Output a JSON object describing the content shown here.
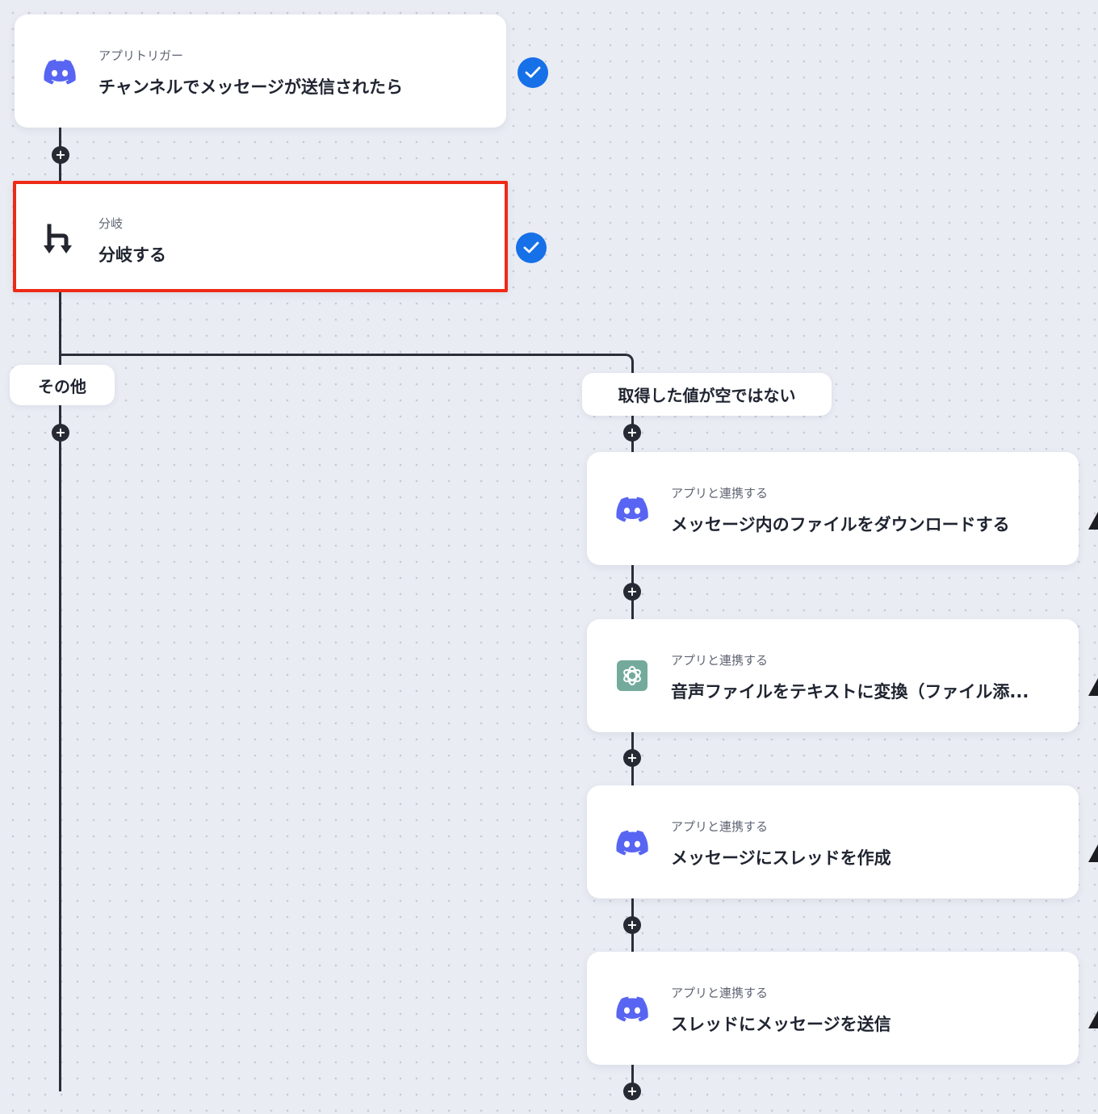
{
  "flow": {
    "trigger": {
      "icon": "discord-icon",
      "subtitle": "アプリトリガー",
      "title": "チャンネルでメッセージが送信されたら",
      "status": "complete"
    },
    "branch": {
      "icon": "branch-icon",
      "subtitle": "分岐",
      "title": "分岐する",
      "status": "complete",
      "selected": true
    },
    "branches": {
      "other_label": "その他",
      "condition_label": "取得した値が空ではない"
    },
    "steps": [
      {
        "icon": "discord-icon",
        "subtitle": "アプリと連携する",
        "title": "メッセージ内のファイルをダウンロードする"
      },
      {
        "icon": "openai-icon",
        "subtitle": "アプリと連携する",
        "title": "音声ファイルをテキストに変換（ファイル添..."
      },
      {
        "icon": "discord-icon",
        "subtitle": "アプリと連携する",
        "title": "メッセージにスレッドを作成"
      },
      {
        "icon": "discord-icon",
        "subtitle": "アプリと連携する",
        "title": "スレッドにメッセージを送信"
      }
    ]
  },
  "colors": {
    "discord": "#5865f2",
    "openai": "#74aa9c",
    "check": "#1670e8",
    "selected_border": "#ee2a16",
    "connector": "#2a2e38"
  }
}
